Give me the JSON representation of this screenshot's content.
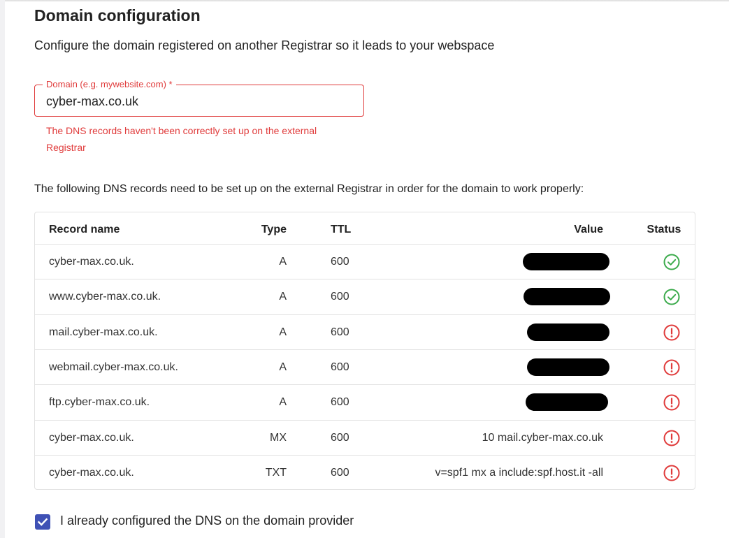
{
  "page": {
    "title": "Domain configuration",
    "subtitle": "Configure the domain registered on another Registrar so it leads to your webspace"
  },
  "domain_field": {
    "label": "Domain (e.g. mywebsite.com) *",
    "value": "cyber-max.co.uk",
    "error": "The DNS records haven't been correctly set up on the external Registrar"
  },
  "records_intro": "The following DNS records need to be set up on the external Registrar in order for the domain to work properly:",
  "table": {
    "headers": {
      "name": "Record name",
      "type": "Type",
      "ttl": "TTL",
      "value": "Value",
      "status": "Status"
    },
    "rows": [
      {
        "name": "cyber-max.co.uk.",
        "type": "A",
        "ttl": "600",
        "value": "",
        "redacted": true,
        "status": "ok"
      },
      {
        "name": "www.cyber-max.co.uk.",
        "type": "A",
        "ttl": "600",
        "value": "",
        "redacted": true,
        "status": "ok"
      },
      {
        "name": "mail.cyber-max.co.uk.",
        "type": "A",
        "ttl": "600",
        "value": "",
        "redacted": true,
        "status": "error"
      },
      {
        "name": "webmail.cyber-max.co.uk.",
        "type": "A",
        "ttl": "600",
        "value": "",
        "redacted": true,
        "status": "error"
      },
      {
        "name": "ftp.cyber-max.co.uk.",
        "type": "A",
        "ttl": "600",
        "value": "",
        "redacted": true,
        "status": "error"
      },
      {
        "name": "cyber-max.co.uk.",
        "type": "MX",
        "ttl": "600",
        "value": "10 mail.cyber-max.co.uk",
        "redacted": false,
        "status": "error"
      },
      {
        "name": "cyber-max.co.uk.",
        "type": "TXT",
        "ttl": "600",
        "value": "v=spf1 mx a include:spf.host.it -all",
        "redacted": false,
        "status": "error"
      }
    ]
  },
  "confirm": {
    "label": "I already configured the DNS on the domain provider",
    "checked": true
  },
  "colors": {
    "error": "#e03b3b",
    "ok": "#3cab4c",
    "checkbox": "#3f51b5"
  }
}
